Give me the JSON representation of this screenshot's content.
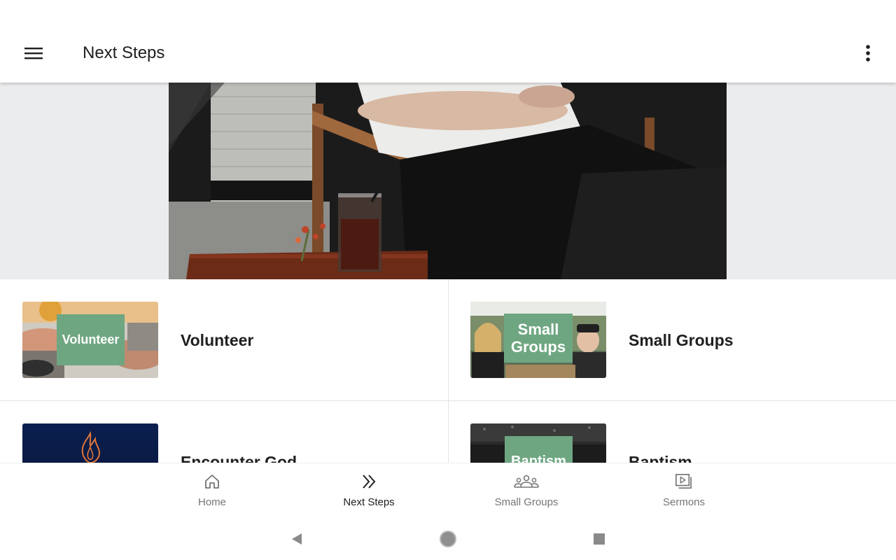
{
  "app_bar": {
    "title": "Next Steps",
    "menu_icon": "hamburger-menu-icon",
    "more_icon": "more-vert-icon"
  },
  "hero": {
    "image": "person-seated-with-drink-photo"
  },
  "steps": [
    {
      "label": "Volunteer",
      "thumb_text": "Volunteer"
    },
    {
      "label": "Small Groups",
      "thumb_text_line1": "Small",
      "thumb_text_line2": "Groups"
    },
    {
      "label": "Encounter God",
      "thumb_icon": "flame-icon"
    },
    {
      "label": "Baptism",
      "thumb_text": "Baptism"
    }
  ],
  "bottom_nav": [
    {
      "label": "Home",
      "icon": "home-icon",
      "active": false
    },
    {
      "label": "Next Steps",
      "icon": "double-chevron-right-icon",
      "active": true
    },
    {
      "label": "Small Groups",
      "icon": "groups-icon",
      "active": false
    },
    {
      "label": "Sermons",
      "icon": "video-library-icon",
      "active": false
    }
  ],
  "system_nav": {
    "back_icon": "back-triangle-icon",
    "home_icon": "home-circle-icon",
    "recents_icon": "recents-square-icon"
  },
  "colors": {
    "accent_green": "#6fa682",
    "hero_background": "#ebeced",
    "nav_inactive": "#757575",
    "text_primary": "#202020"
  }
}
